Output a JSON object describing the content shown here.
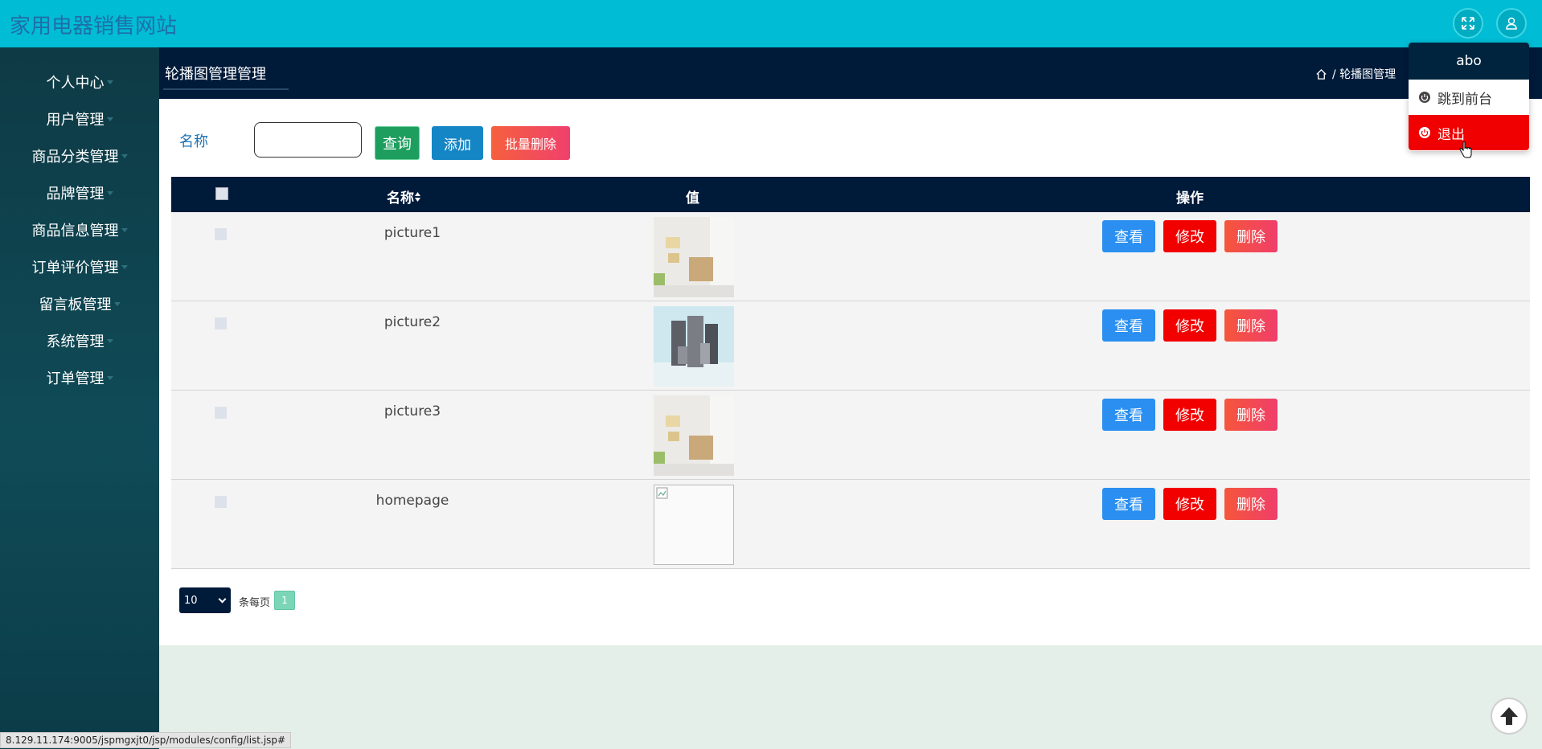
{
  "header": {
    "site_title": "家用电器销售网站",
    "fullscreen_icon": "expand-icon",
    "user_icon": "user-icon"
  },
  "sidebar": {
    "items": [
      {
        "label": "个人中心"
      },
      {
        "label": "用户管理"
      },
      {
        "label": "商品分类管理"
      },
      {
        "label": "品牌管理"
      },
      {
        "label": "商品信息管理"
      },
      {
        "label": "订单评价管理"
      },
      {
        "label": "留言板管理"
      },
      {
        "label": "系统管理"
      },
      {
        "label": "订单管理"
      }
    ]
  },
  "page": {
    "tab_title": "轮播图管理管理",
    "breadcrumb_text": "/ 轮播图管理"
  },
  "search": {
    "label": "名称",
    "value": "",
    "query_label": "查询",
    "add_label": "添加",
    "batch_delete_label": "批量删除"
  },
  "table": {
    "headers": {
      "name": "名称",
      "value": "值",
      "actions": "操作"
    },
    "sort_icon": "sort-icon",
    "rows": [
      {
        "name": "picture1",
        "image": "room-image"
      },
      {
        "name": "picture2",
        "image": "appliances-image"
      },
      {
        "name": "picture3",
        "image": "room-image"
      },
      {
        "name": "homepage",
        "image": "broken-image"
      }
    ],
    "actions": {
      "view": "查看",
      "edit": "修改",
      "delete": "删除"
    }
  },
  "pager": {
    "page_size": "10",
    "page_size_label": "条每页",
    "current_page": "1"
  },
  "user_menu": {
    "username": "abo",
    "front_label": "跳到前台",
    "logout_label": "退出"
  },
  "status_url": "8.129.11.174:9005/jspmgxjt0/jsp/modules/config/list.jsp#",
  "colors": {
    "topbar": "#00bcd4",
    "dark": "#001a3a",
    "sidebar": "#0f4b57",
    "view": "#2a8ff0",
    "edit": "#f20000",
    "delete": "#f03e6a"
  }
}
